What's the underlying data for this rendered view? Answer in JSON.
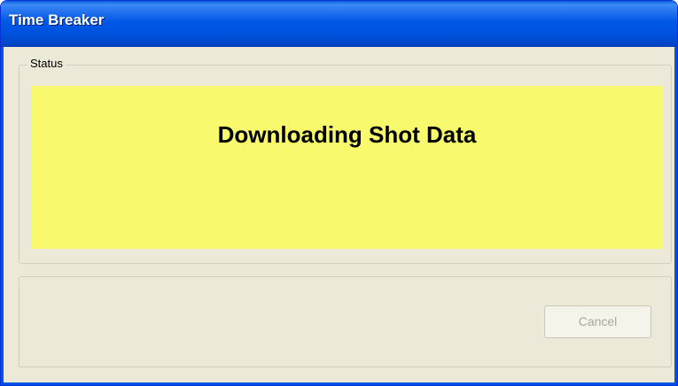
{
  "window": {
    "title": "Time Breaker"
  },
  "status_group": {
    "legend": "Status",
    "message": "Downloading Shot Data",
    "panel_color": "#f8f96d"
  },
  "actions": {
    "cancel_label": "Cancel",
    "cancel_enabled": false
  },
  "colors": {
    "titlebar": "#0058e6",
    "window_bg": "#ece9d8"
  }
}
